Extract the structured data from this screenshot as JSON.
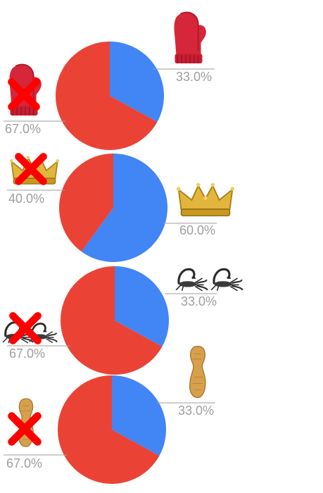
{
  "colors": {
    "yes": "#4285f4",
    "no": "#ea4335",
    "label": "#9e9e9e",
    "cross": "#ff0000"
  },
  "chart_data": [
    {
      "type": "pie",
      "icon": "mitten-icon",
      "values": [
        33.0,
        67.0
      ],
      "labels": [
        "33.0%",
        "67.0%"
      ]
    },
    {
      "type": "pie",
      "icon": "crown-icon",
      "values": [
        60.0,
        40.0
      ],
      "labels": [
        "60.0%",
        "40.0%"
      ]
    },
    {
      "type": "pie",
      "icon": "scorpion-icon",
      "values": [
        33.0,
        67.0
      ],
      "labels": [
        "33.0%",
        "67.0%"
      ]
    },
    {
      "type": "pie",
      "icon": "peanut-icon",
      "values": [
        33.0,
        67.0
      ],
      "labels": [
        "33.0%",
        "67.0%"
      ]
    }
  ]
}
